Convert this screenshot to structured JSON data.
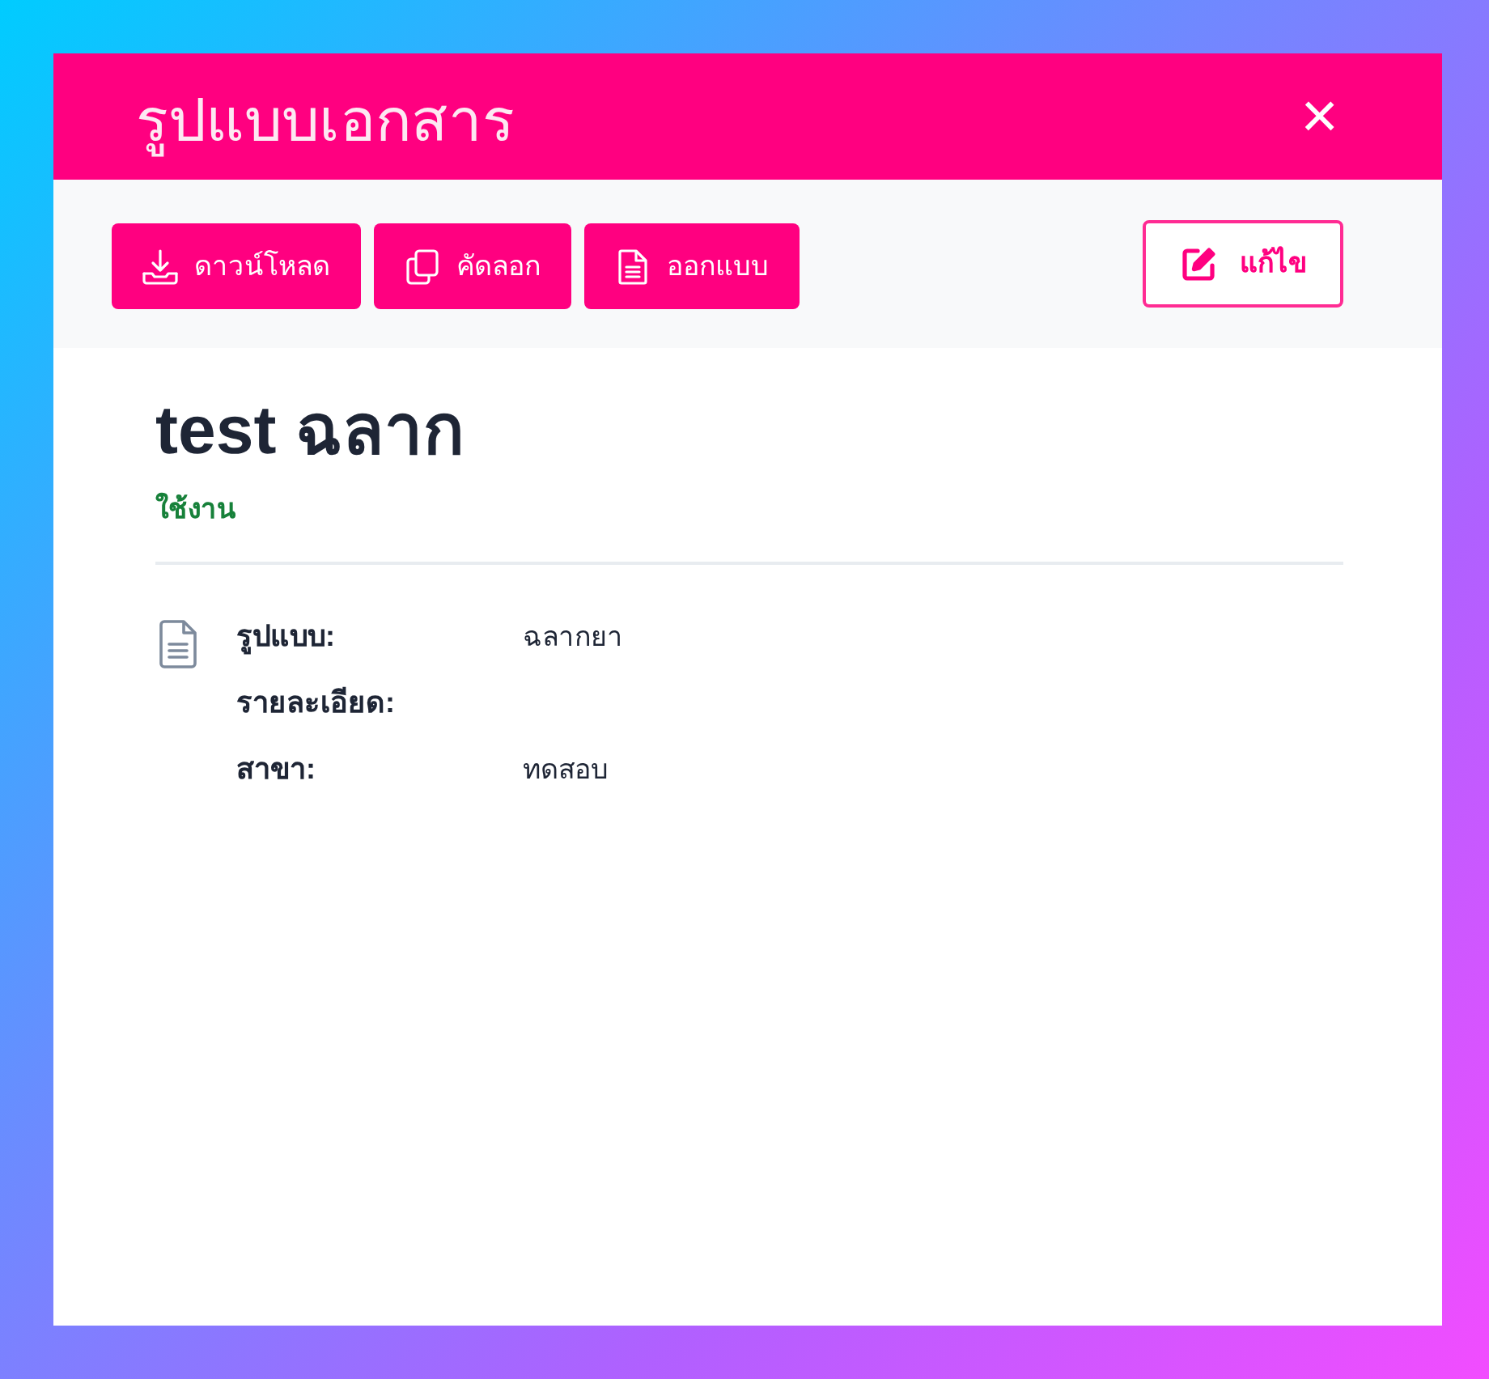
{
  "dialog": {
    "title": "รูปแบบเอกสาร",
    "close": "×"
  },
  "toolbar": {
    "actions": [
      {
        "kind": "download",
        "label": "ดาวน์โหลด"
      },
      {
        "kind": "copy",
        "label": "คัดลอก"
      },
      {
        "kind": "export",
        "label": "ออกแบบ"
      }
    ],
    "edit_button": {
      "label": "แก้ไข"
    }
  },
  "document": {
    "name": "test ฉลาก",
    "status": {
      "label": "ใช้งาน",
      "active": true
    }
  },
  "details": [
    {
      "label": "รูปแบบ:",
      "value": "ฉลากยา"
    },
    {
      "label": "รายละเอียด:"
    },
    {
      "label": "สาขา:",
      "value": "ทดสอบ"
    }
  ]
}
